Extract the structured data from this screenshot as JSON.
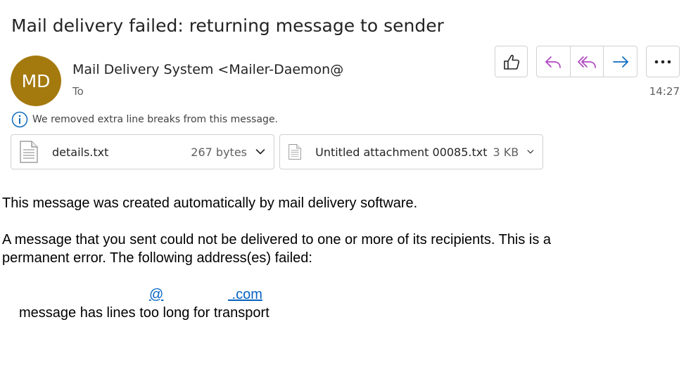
{
  "subject": "Mail delivery failed: returning message to sender",
  "sender": {
    "initials": "MD",
    "avatar_color": "#a4790e",
    "name": "Mail Delivery System <Mailer-Daemon@",
    "to_label": "To",
    "time": "14:27"
  },
  "toolbar": {
    "like_icon": "thumbs-up-icon",
    "reply_icon": "reply-icon",
    "reply_all_icon": "reply-all-icon",
    "forward_icon": "forward-icon",
    "more_icon": "more-horizontal-icon",
    "accent_color": "#b146c2",
    "forward_color": "#0f6cbd"
  },
  "info_bar": {
    "icon": "info-icon",
    "text": "We removed extra line breaks from this message."
  },
  "attachments": [
    {
      "name": "details.txt",
      "size": "267 bytes"
    },
    {
      "name": "Untitled attachment 00085.txt",
      "size": "3 KB"
    }
  ],
  "body": {
    "line1": "This message was created automatically by mail delivery software.",
    "line2": "A message that you sent could not be delivered to one or more of its recipients. This is a",
    "line3": "permanent error. The following address(es) failed:",
    "address_at": "@",
    "address_domain": " .com",
    "line4": "message has lines too long for transport"
  }
}
